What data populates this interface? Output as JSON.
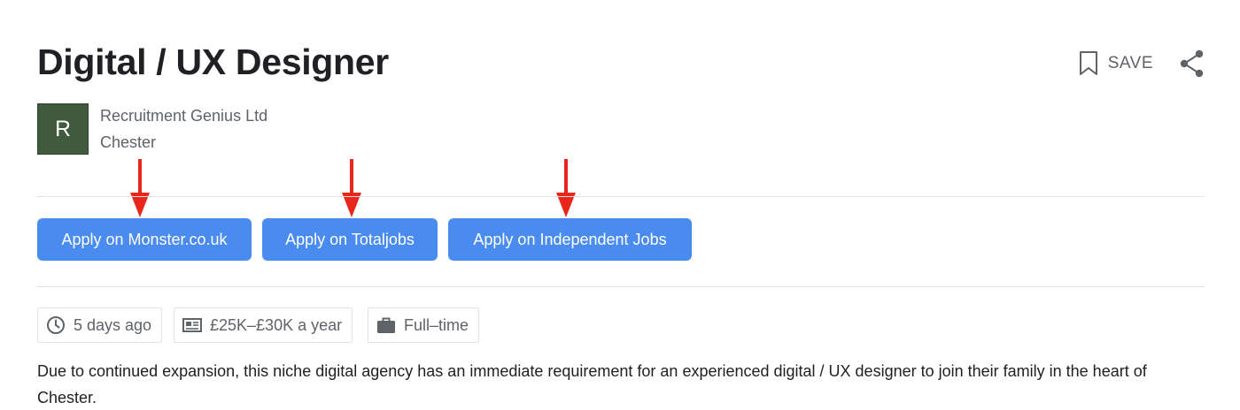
{
  "job": {
    "title": "Digital / UX Designer",
    "save_label": "SAVE",
    "company": {
      "logo_letter": "R",
      "logo_color": "#3f5a3c",
      "name": "Recruitment Genius Ltd",
      "location": "Chester"
    },
    "apply_buttons": [
      {
        "label": "Apply on Monster.co.uk"
      },
      {
        "label": "Apply on Totaljobs"
      },
      {
        "label": "Apply on Independent Jobs"
      }
    ],
    "chips": [
      {
        "icon": "clock-icon",
        "text": "5 days ago"
      },
      {
        "icon": "salary-card-icon",
        "text": "£25K–£30K a year"
      },
      {
        "icon": "briefcase-icon",
        "text": "Full–time"
      }
    ],
    "description": "Due to continued expansion, this niche digital agency has an immediate requirement for an experienced digital / UX designer to join their family in the heart of Chester."
  },
  "colors": {
    "accent": "#4a8bf0",
    "annotation_arrow": "#e8261a",
    "text_secondary": "#5f6368"
  },
  "annotations": {
    "arrows": [
      {
        "icon": "red-arrow-down-icon",
        "points_to": "Apply on Monster.co.uk"
      },
      {
        "icon": "red-arrow-down-icon",
        "points_to": "Apply on Totaljobs"
      },
      {
        "icon": "red-arrow-down-icon",
        "points_to": "Apply on Independent Jobs"
      }
    ]
  }
}
